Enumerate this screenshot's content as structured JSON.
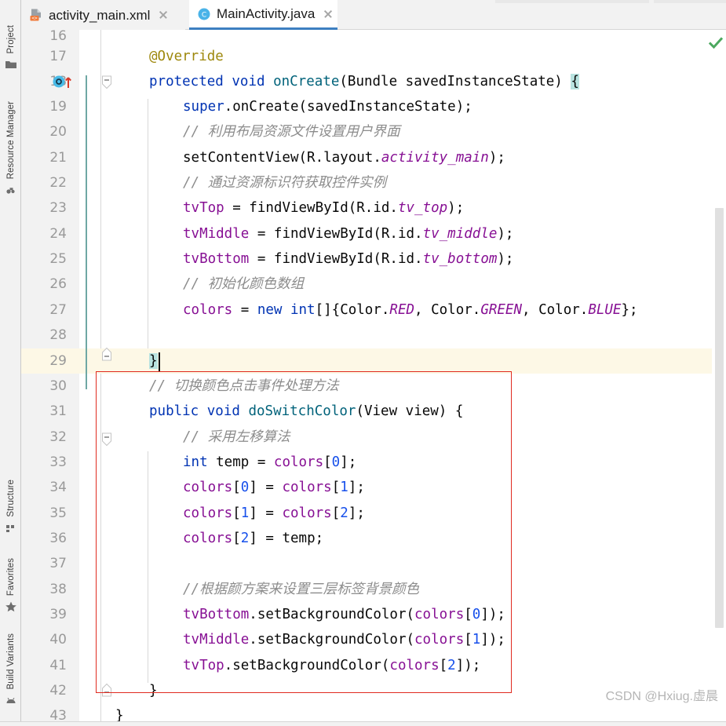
{
  "window": {
    "app": "Android Studio Editor",
    "watermark": "CSDN @Hxiug.虚晨"
  },
  "toolwindows": {
    "top": [
      {
        "label": "Project",
        "icon": "folder-icon"
      },
      {
        "label": "Resource Manager",
        "icon": "resource-manager-icon"
      }
    ],
    "bottom": [
      {
        "label": "Structure",
        "icon": "structure-icon"
      },
      {
        "label": "Favorites",
        "icon": "star-icon"
      },
      {
        "label": "Build Variants",
        "icon": "android-icon"
      }
    ]
  },
  "tabs": [
    {
      "label": "activity_main.xml",
      "icon": "xml-layout-icon",
      "active": false,
      "close": "close-icon"
    },
    {
      "label": "MainActivity.java",
      "icon": "java-class-icon",
      "active": true,
      "close": "close-icon"
    }
  ],
  "editor": {
    "accent_active_tab": "#3d7fc1",
    "caret_line_color": "#fdf8e6",
    "annotation_box_color": "#e02b20",
    "inspection_status": "check-icon",
    "first_visible_line": 16,
    "lines": [
      {
        "n": 16,
        "text": ""
      },
      {
        "n": 17,
        "text": "    @Override"
      },
      {
        "n": 18,
        "text": "    protected void onCreate(Bundle savedInstanceState) {"
      },
      {
        "n": 19,
        "text": "        super.onCreate(savedInstanceState);"
      },
      {
        "n": 20,
        "text": "        // 利用布局资源文件设置用户界面"
      },
      {
        "n": 21,
        "text": "        setContentView(R.layout.activity_main);"
      },
      {
        "n": 22,
        "text": "        // 通过资源标识符获取控件实例"
      },
      {
        "n": 23,
        "text": "        tvTop = findViewById(R.id.tv_top);"
      },
      {
        "n": 24,
        "text": "        tvMiddle = findViewById(R.id.tv_middle);"
      },
      {
        "n": 25,
        "text": "        tvBottom = findViewById(R.id.tv_bottom);"
      },
      {
        "n": 26,
        "text": "        // 初始化颜色数组"
      },
      {
        "n": 27,
        "text": "        colors = new int[]{Color.RED, Color.GREEN, Color.BLUE};"
      },
      {
        "n": 28,
        "text": ""
      },
      {
        "n": 29,
        "text": "    }"
      },
      {
        "n": 30,
        "text": "    // 切换颜色点击事件处理方法"
      },
      {
        "n": 31,
        "text": "    public void doSwitchColor(View view) {"
      },
      {
        "n": 32,
        "text": "        // 采用左移算法"
      },
      {
        "n": 33,
        "text": "        int temp = colors[0];"
      },
      {
        "n": 34,
        "text": "        colors[0] = colors[1];"
      },
      {
        "n": 35,
        "text": "        colors[1] = colors[2];"
      },
      {
        "n": 36,
        "text": "        colors[2] = temp;"
      },
      {
        "n": 37,
        "text": ""
      },
      {
        "n": 38,
        "text": "        //根据颜方案来设置三层标签背景颜色"
      },
      {
        "n": 39,
        "text": "        tvBottom.setBackgroundColor(colors[0]);"
      },
      {
        "n": 40,
        "text": "        tvMiddle.setBackgroundColor(colors[1]);"
      },
      {
        "n": 41,
        "text": "        tvTop.setBackgroundColor(colors[2]);"
      },
      {
        "n": 42,
        "text": "    }"
      },
      {
        "n": 43,
        "text": "}"
      }
    ],
    "caret_line": 29,
    "gutter_run_line": 18,
    "fold_lines": [
      18,
      29,
      31,
      42
    ]
  }
}
